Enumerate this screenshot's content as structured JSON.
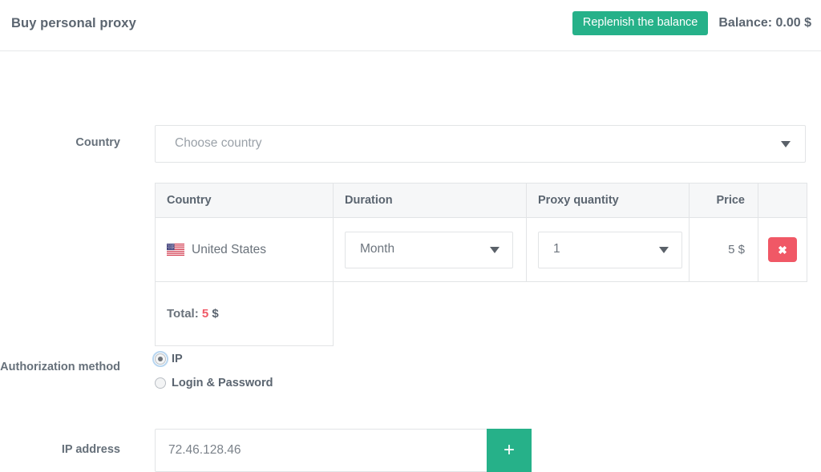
{
  "header": {
    "title": "Buy personal proxy",
    "replenish_label": "Replenish the balance",
    "balance_label": "Balance: 0.00 $",
    "accent_color": "#26b189"
  },
  "form": {
    "country_row_label": "Country",
    "country_placeholder": "Choose country",
    "auth_row_label": "Authorization method",
    "ip_row_label": "IP address"
  },
  "table": {
    "headers": [
      "Country",
      "Duration",
      "Proxy quantity",
      "Price",
      ""
    ],
    "rows": [
      {
        "country": "United States",
        "flag": "us-flag-icon",
        "duration": "Month",
        "quantity": "1",
        "price": "5 $",
        "delete_label": "✖"
      }
    ],
    "total_label": "Total:",
    "total_amount": "5",
    "total_currency": "$",
    "total_color": "#f05866",
    "delete_color": "#f05866"
  },
  "auth": {
    "options": [
      {
        "label": "IP",
        "selected": true
      },
      {
        "label": "Login & Password",
        "selected": false
      }
    ]
  },
  "ip": {
    "value": "72.46.128.46",
    "placeholder": "IP address",
    "add_label": "+"
  }
}
